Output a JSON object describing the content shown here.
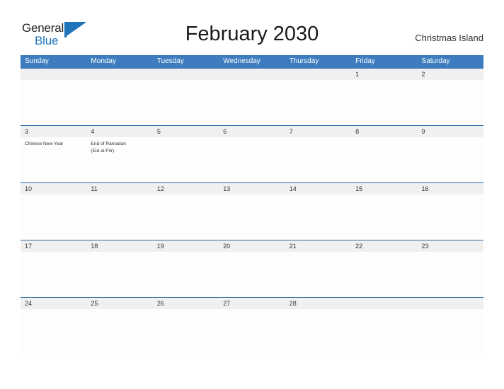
{
  "logo": {
    "word_one": "General",
    "word_two": "Blue",
    "flag_icon": "blue-triangle-flag-icon",
    "flag_color": "#1f74bb",
    "text_color": "#231f20"
  },
  "header": {
    "title": "February 2030",
    "locale": "Christmas Island"
  },
  "colors": {
    "weekday_header_bg": "#3c7cbf",
    "weekday_header_text": "#ffffff",
    "date_band_bg": "#f0f0f0",
    "week_separator": "#2b6ca8",
    "cell_bg": "#fdfdfd",
    "body_text": "#333333"
  },
  "calendar": {
    "month": "February",
    "year": "2030",
    "weekdays": [
      "Sunday",
      "Monday",
      "Tuesday",
      "Wednesday",
      "Thursday",
      "Friday",
      "Saturday"
    ],
    "weeks": [
      {
        "days": [
          {
            "date": "",
            "events": []
          },
          {
            "date": "",
            "events": []
          },
          {
            "date": "",
            "events": []
          },
          {
            "date": "",
            "events": []
          },
          {
            "date": "",
            "events": []
          },
          {
            "date": "1",
            "events": []
          },
          {
            "date": "2",
            "events": []
          }
        ]
      },
      {
        "days": [
          {
            "date": "3",
            "events": [
              "Chinese New Year"
            ]
          },
          {
            "date": "4",
            "events": [
              "End of Ramadan",
              "(Eid al-Fitr)"
            ]
          },
          {
            "date": "5",
            "events": []
          },
          {
            "date": "6",
            "events": []
          },
          {
            "date": "7",
            "events": []
          },
          {
            "date": "8",
            "events": []
          },
          {
            "date": "9",
            "events": []
          }
        ]
      },
      {
        "days": [
          {
            "date": "10",
            "events": []
          },
          {
            "date": "11",
            "events": []
          },
          {
            "date": "12",
            "events": []
          },
          {
            "date": "13",
            "events": []
          },
          {
            "date": "14",
            "events": []
          },
          {
            "date": "15",
            "events": []
          },
          {
            "date": "16",
            "events": []
          }
        ]
      },
      {
        "days": [
          {
            "date": "17",
            "events": []
          },
          {
            "date": "18",
            "events": []
          },
          {
            "date": "19",
            "events": []
          },
          {
            "date": "20",
            "events": []
          },
          {
            "date": "21",
            "events": []
          },
          {
            "date": "22",
            "events": []
          },
          {
            "date": "23",
            "events": []
          }
        ]
      },
      {
        "days": [
          {
            "date": "24",
            "events": []
          },
          {
            "date": "25",
            "events": []
          },
          {
            "date": "26",
            "events": []
          },
          {
            "date": "27",
            "events": []
          },
          {
            "date": "28",
            "events": []
          },
          {
            "date": "",
            "events": []
          },
          {
            "date": "",
            "events": []
          }
        ]
      }
    ]
  }
}
